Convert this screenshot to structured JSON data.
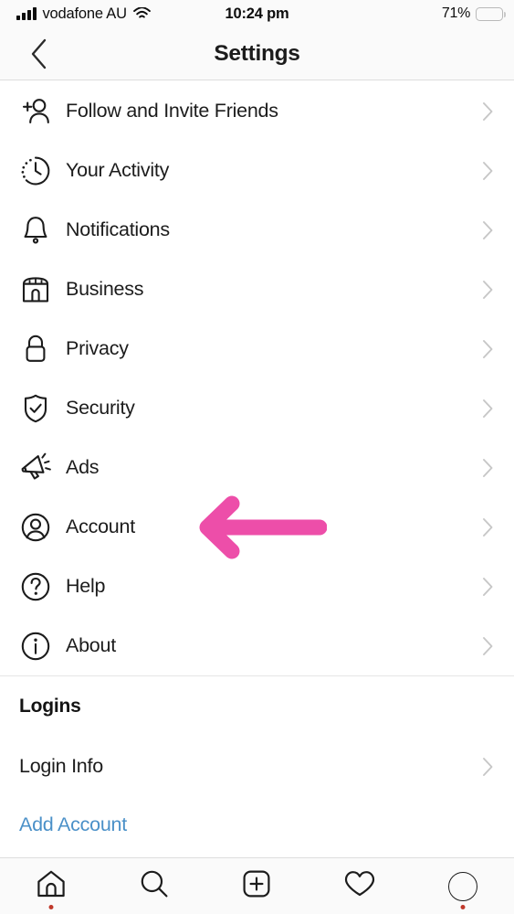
{
  "status_bar": {
    "carrier": "vodafone AU",
    "signal_icon": "signal-bars-icon",
    "wifi_icon": "wifi-icon",
    "time": "10:24 pm",
    "battery_percent": "71%",
    "battery_fill_ratio": 0.71,
    "battery_color": "#f7cb2e"
  },
  "nav": {
    "back_icon": "chevron-left-icon",
    "title": "Settings"
  },
  "settings_list": [
    {
      "label": "Follow and Invite Friends",
      "icon": "person-plus-icon",
      "chevron": true
    },
    {
      "label": "Your Activity",
      "icon": "clock-activity-icon",
      "chevron": true
    },
    {
      "label": "Notifications",
      "icon": "bell-icon",
      "chevron": true
    },
    {
      "label": "Business",
      "icon": "storefront-icon",
      "chevron": true
    },
    {
      "label": "Privacy",
      "icon": "lock-icon",
      "chevron": true
    },
    {
      "label": "Security",
      "icon": "shield-check-icon",
      "chevron": true
    },
    {
      "label": "Ads",
      "icon": "megaphone-icon",
      "chevron": true
    },
    {
      "label": "Account",
      "icon": "account-circle-icon",
      "chevron": true
    },
    {
      "label": "Help",
      "icon": "question-circle-icon",
      "chevron": true
    },
    {
      "label": "About",
      "icon": "info-circle-icon",
      "chevron": true
    }
  ],
  "logins_section": {
    "header": "Logins",
    "login_info_label": "Login Info",
    "add_account_label": "Add Account",
    "link_color": "#4a90c8"
  },
  "annotation": {
    "type": "arrow-left",
    "color": "#ed4ea9",
    "points_at": "Account"
  },
  "tab_bar": [
    {
      "icon": "home-icon",
      "badge_dot": true
    },
    {
      "icon": "search-icon",
      "badge_dot": false
    },
    {
      "icon": "add-post-icon",
      "badge_dot": false
    },
    {
      "icon": "heart-activity-icon",
      "badge_dot": false
    },
    {
      "icon": "profile-avatar-icon",
      "badge_dot": true
    }
  ],
  "colors": {
    "background": "#ffffff",
    "chrome": "#fafafa",
    "border": "#dedede",
    "text": "#1c1c1c",
    "chevron": "#c7c7c7"
  }
}
